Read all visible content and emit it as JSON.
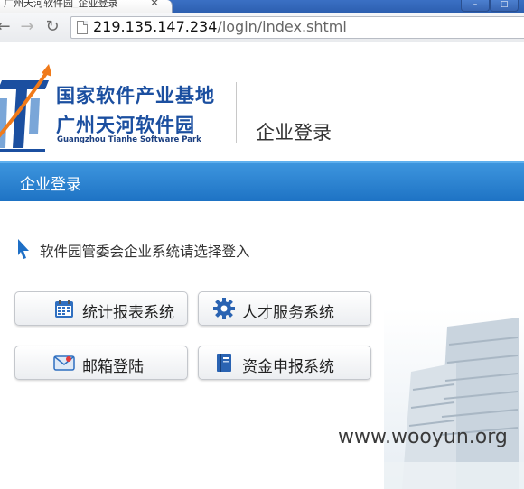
{
  "browser": {
    "tab_title": "广州天河软件园_企业登录",
    "url_host": "219.135.147.234",
    "url_path": "/login/index.shtml"
  },
  "header": {
    "logo_line1": "国家软件产业基地",
    "logo_line2": "广州天河软件园",
    "logo_en": "Guangzhou Tianhe Software Park",
    "title": "企业登录"
  },
  "nav": {
    "label": "企业登录"
  },
  "main": {
    "instruction": "软件园管委会企业系统请选择登入",
    "buttons": [
      {
        "label": "统计报表系统",
        "icon": "calendar-icon"
      },
      {
        "label": "人才服务系统",
        "icon": "gear-icon"
      },
      {
        "label": "邮箱登陆",
        "icon": "mail-icon"
      },
      {
        "label": "资金申报系统",
        "icon": "book-icon"
      }
    ]
  },
  "watermark": "www.wooyun.org",
  "colors": {
    "brand_blue": "#1b4fa0",
    "nav_blue": "#2a82d2",
    "accent_orange": "#f07a1a"
  }
}
